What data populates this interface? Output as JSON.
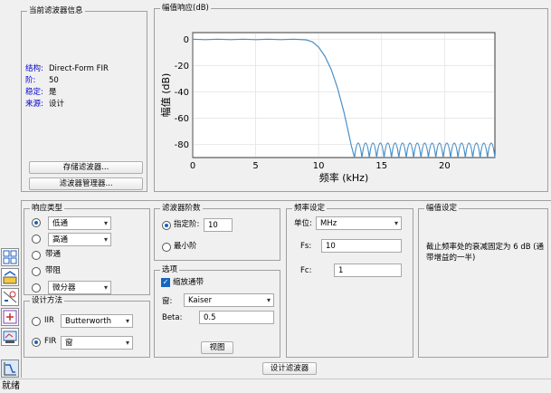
{
  "info_panel": {
    "title": "当前滤波器信息",
    "rows": [
      {
        "label": "结构:",
        "value": "Direct-Form FIR"
      },
      {
        "label": "阶:",
        "value": "50"
      },
      {
        "label": "稳定:",
        "value": "是"
      },
      {
        "label": "来源:",
        "value": "设计"
      }
    ],
    "store_button": "存储滤波器...",
    "manager_button": "滤波器管理器..."
  },
  "chart_panel": {
    "title": "幅值响应(dB)"
  },
  "chart_data": {
    "type": "line",
    "xlabel": "频率 (kHz)",
    "ylabel": "幅值 (dB)",
    "xlim": [
      0,
      24
    ],
    "ylim": [
      -90,
      5
    ],
    "xticks": [
      "0",
      "5",
      "10",
      "15",
      "20"
    ],
    "yticks": [
      "0",
      "-20",
      "-40",
      "-60",
      "-80"
    ],
    "xtick_values": [
      0,
      5,
      10,
      15,
      20
    ],
    "ytick_values": [
      0,
      -20,
      -40,
      -60,
      -80
    ],
    "grid": true,
    "series": [
      {
        "color": "#4a90c8",
        "x": [
          0,
          1,
          2,
          3,
          4,
          5,
          6,
          7,
          8,
          9,
          9.5,
          10,
          10.5,
          11,
          11.5,
          12,
          12.3,
          12.6,
          12.85
        ],
        "y": [
          0,
          -0.4,
          0,
          -0.4,
          0,
          -0.4,
          0,
          -0.4,
          0,
          -0.5,
          -2,
          -6,
          -13,
          -23,
          -37,
          -55,
          -68,
          -81,
          -90
        ]
      }
    ],
    "stopband": {
      "start": 12.85,
      "end": 24,
      "lobes": 19,
      "peak": -79,
      "floor": -90
    }
  },
  "response_type": {
    "title": "响应类型",
    "options": [
      {
        "label": "",
        "select": "低通",
        "selected": true
      },
      {
        "label": "",
        "select": "高通",
        "selected": false
      },
      {
        "label": "带通",
        "select": "",
        "selected": false
      },
      {
        "label": "带阻",
        "select": "",
        "selected": false
      },
      {
        "label": "",
        "select": "微分器",
        "selected": false
      }
    ]
  },
  "design_method": {
    "title": "设计方法",
    "iir_label": "IIR",
    "iir_select": "Butterworth",
    "fir_label": "FIR",
    "fir_select": "窗"
  },
  "filter_order": {
    "title": "滤波器阶数",
    "specify_label": "指定阶:",
    "specify_value": "10",
    "minimum_label": "最小阶"
  },
  "options": {
    "title": "选项",
    "scale_passband": "缩放通带",
    "window_label": "窗:",
    "window_value": "Kaiser",
    "beta_label": "Beta:",
    "beta_value": "0.5",
    "view_button": "视图"
  },
  "freq_spec": {
    "title": "频率设定",
    "units_label": "单位:",
    "units_value": "MHz",
    "fs_label": "Fs:",
    "fs_value": "10",
    "fc_label": "Fc:",
    "fc_value": "1"
  },
  "mag_spec": {
    "title": "幅值设定",
    "text": "截止频率处的衰减固定为 6 dB (通带增益的一半)"
  },
  "design_button": "设计滤波器",
  "status": "就绪"
}
